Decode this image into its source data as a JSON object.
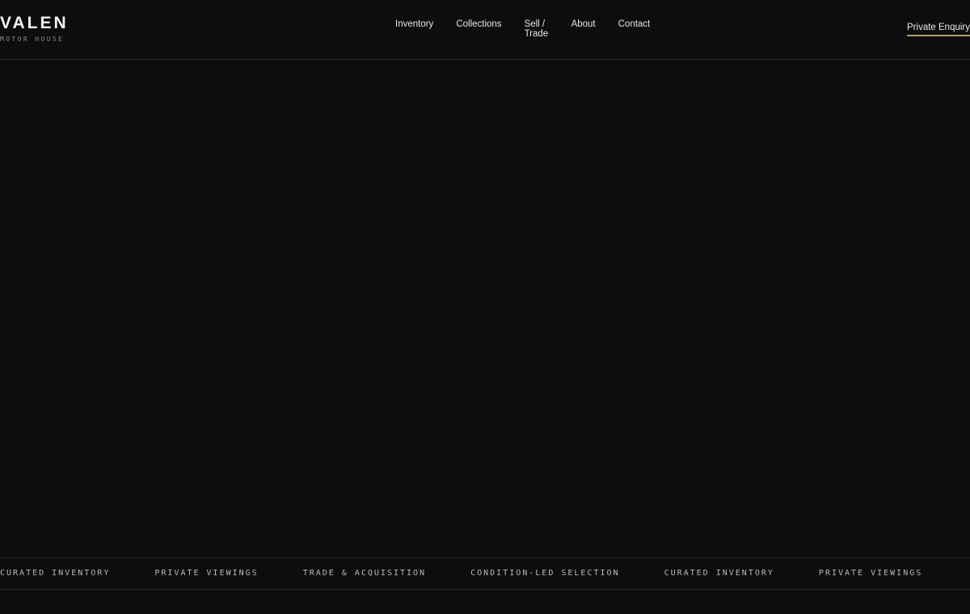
{
  "brand": {
    "name": "VALEN",
    "subtitle": "MOTOR HOUSE"
  },
  "nav": {
    "items": [
      {
        "label": "Inventory"
      },
      {
        "label": "Collections"
      },
      {
        "label": "Sell / Trade"
      },
      {
        "label": "About"
      },
      {
        "label": "Contact"
      }
    ]
  },
  "cta": {
    "label": "Private Enquiry",
    "underline_color": "#b5a06e"
  },
  "ticker": {
    "items": [
      "CURATED INVENTORY",
      "PRIVATE VIEWINGS",
      "TRADE & ACQUISITION",
      "CONDITION-LED SELECTION",
      "CURATED INVENTORY",
      "PRIVATE VIEWINGS"
    ]
  },
  "colors": {
    "background": "#0c0d0f",
    "text": "#e8e8e8",
    "accent": "#b5a06e"
  }
}
